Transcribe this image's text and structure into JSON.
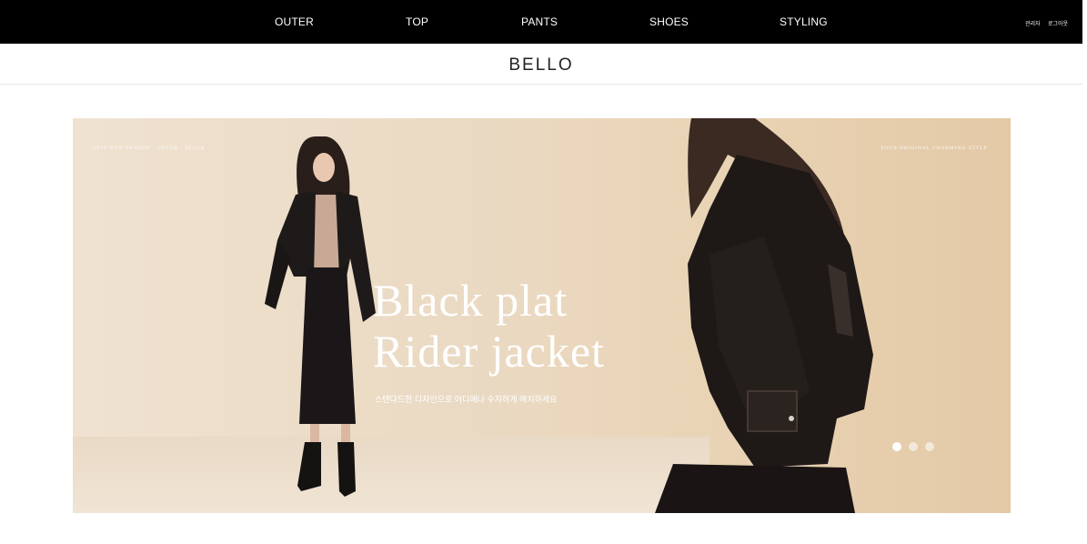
{
  "nav": {
    "items": [
      "OUTER",
      "TOP",
      "PANTS",
      "SHOES",
      "STYLING"
    ],
    "utility": {
      "admin": "관리자",
      "logout": "로그아웃"
    }
  },
  "brand": {
    "name": "BELLO"
  },
  "hero": {
    "caption_left": "2019 NEW SEASON  ·  COLOR : BLACK",
    "caption_right": "YOUR ORIGINAL CHARMING STYLE",
    "headline_line1": "Black plat",
    "headline_line2": "Rider jacket",
    "subtitle": "스탠다드한 디자인으로 어디에나 수지하게 매치하세요",
    "slider": {
      "count": 3,
      "active_index": 0
    }
  },
  "colors": {
    "nav_background": "#000000",
    "nav_text": "#ffffff",
    "hero_background": "#ead9c2",
    "slider_active": "#ffffff"
  }
}
